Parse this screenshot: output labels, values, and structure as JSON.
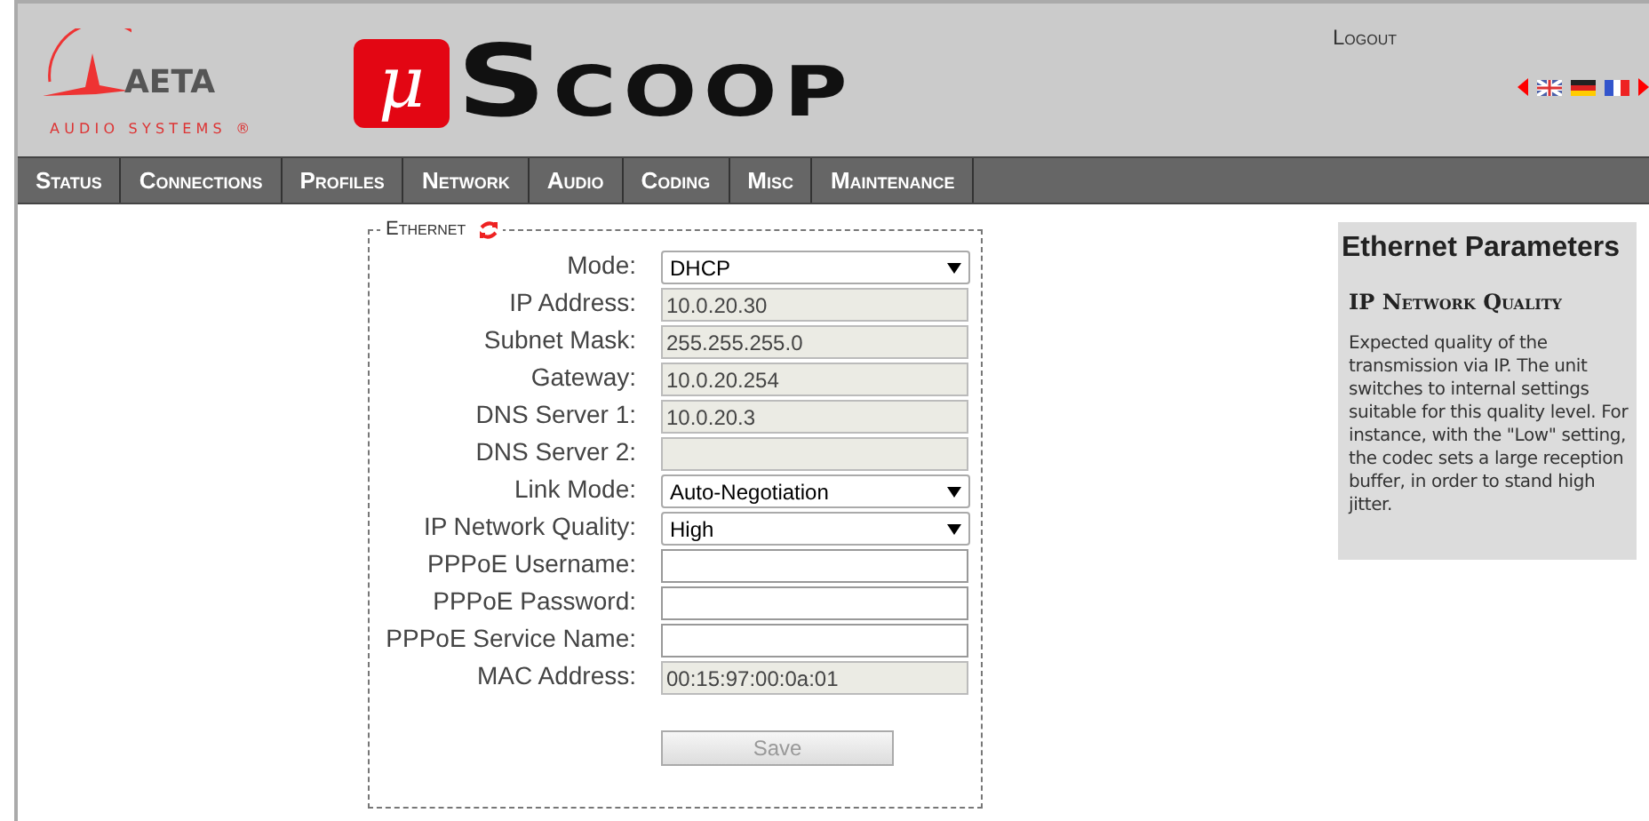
{
  "logo": {
    "brand": "AETA",
    "tagline": "AUDIO SYSTEMS ®"
  },
  "product": {
    "mark": "μ",
    "name": "Scoop"
  },
  "header": {
    "logout": "Logout"
  },
  "nav": [
    "Status",
    "Connections",
    "Profiles",
    "Network",
    "Audio",
    "Coding",
    "Misc",
    "Maintenance"
  ],
  "fieldset": {
    "legend": "Ethernet",
    "fields": [
      {
        "label": "Mode:",
        "kind": "select",
        "value": "DHCP",
        "disabled": false
      },
      {
        "label": "IP Address:",
        "kind": "input",
        "value": "10.0.20.30",
        "disabled": true
      },
      {
        "label": "Subnet Mask:",
        "kind": "input",
        "value": "255.255.255.0",
        "disabled": true
      },
      {
        "label": "Gateway:",
        "kind": "input",
        "value": "10.0.20.254",
        "disabled": true
      },
      {
        "label": "DNS Server 1:",
        "kind": "input",
        "value": "10.0.20.3",
        "disabled": true
      },
      {
        "label": "DNS Server 2:",
        "kind": "input",
        "disabled": true
      },
      {
        "label": "Link Mode:",
        "kind": "select",
        "value": "Auto-Negotiation",
        "disabled": false
      },
      {
        "label": "IP Network Quality:",
        "kind": "select",
        "value": "High",
        "disabled": false
      },
      {
        "label": "PPPoE Username:",
        "kind": "input",
        "disabled": false
      },
      {
        "label": "PPPoE Password:",
        "kind": "input",
        "disabled": false
      },
      {
        "label": "PPPoE Service Name:",
        "kind": "input",
        "disabled": false
      },
      {
        "label": "MAC Address:",
        "kind": "input",
        "value": "00:15:97:00:0a:01",
        "disabled": true
      }
    ],
    "save": {
      "label": "Save",
      "disabled": true
    }
  },
  "help": {
    "title": "Ethernet Parameters",
    "subtitle": "IP Network Quality",
    "text": "Expected quality of the transmission via IP. The unit switches to internal settings suitable for this quality level. For instance, with the \"Low\" setting, the codec sets a large reception buffer, in order to stand high jitter."
  }
}
